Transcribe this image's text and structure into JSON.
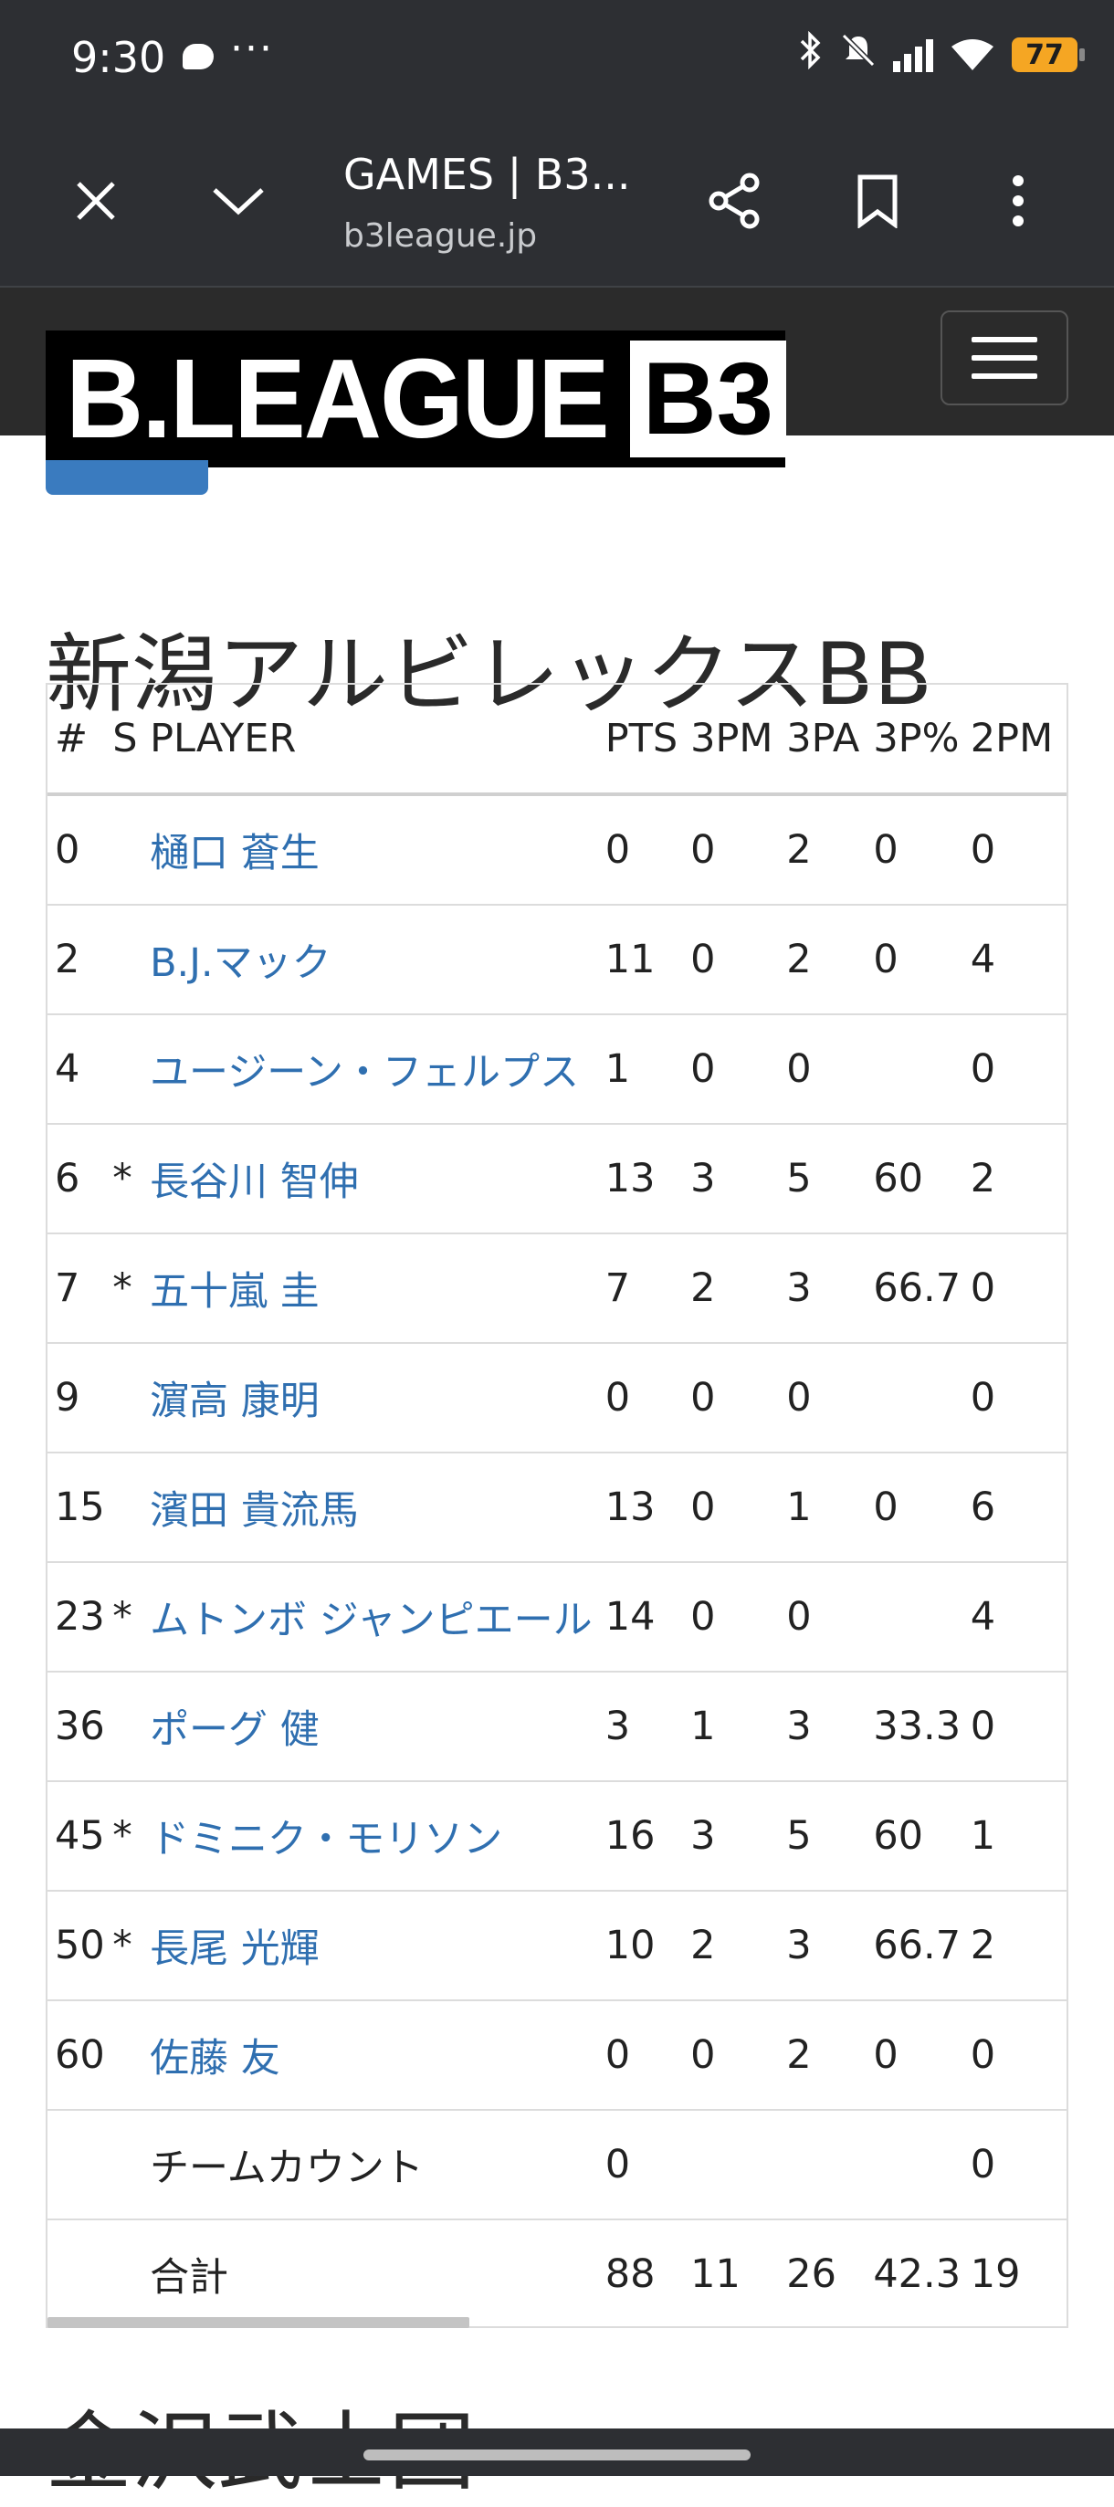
{
  "status_bar": {
    "time": "9:30",
    "dots": "···",
    "battery": "77"
  },
  "browser": {
    "title": "GAMES | B3...",
    "url": "b3league.jp",
    "icons": [
      "close-icon",
      "chevron-down-icon",
      "share-icon",
      "bookmark-icon",
      "more-vert-icon"
    ]
  },
  "site": {
    "logo_text": "B.LEAGUE",
    "logo_badge": "B3"
  },
  "team": {
    "name": "新潟アルビレックスBB"
  },
  "table": {
    "headers": {
      "num": "#",
      "s": "S",
      "player": "PLAYER",
      "pts": "PTS",
      "tpm": "3PM",
      "tpa": "3PA",
      "tpp": "3P%",
      "twopm": "2PM"
    },
    "rows": [
      {
        "num": "0",
        "s": "",
        "player": "樋口 蒼生",
        "pts": "0",
        "tpm": "0",
        "tpa": "2",
        "tpp": "0",
        "twopm": "0"
      },
      {
        "num": "2",
        "s": "",
        "player": "B.J.マック",
        "pts": "11",
        "tpm": "0",
        "tpa": "2",
        "tpp": "0",
        "twopm": "4"
      },
      {
        "num": "4",
        "s": "",
        "player": "ユージーン・フェルプス",
        "pts": "1",
        "tpm": "0",
        "tpa": "0",
        "tpp": "",
        "twopm": "0"
      },
      {
        "num": "6",
        "s": "*",
        "player": "長谷川 智伸",
        "pts": "13",
        "tpm": "3",
        "tpa": "5",
        "tpp": "60",
        "twopm": "2"
      },
      {
        "num": "7",
        "s": "*",
        "player": "五十嵐 圭",
        "pts": "7",
        "tpm": "2",
        "tpa": "3",
        "tpp": "66.7",
        "twopm": "0"
      },
      {
        "num": "9",
        "s": "",
        "player": "濵高 康明",
        "pts": "0",
        "tpm": "0",
        "tpa": "0",
        "tpp": "",
        "twopm": "0"
      },
      {
        "num": "15",
        "s": "",
        "player": "濱田 貴流馬",
        "pts": "13",
        "tpm": "0",
        "tpa": "1",
        "tpp": "0",
        "twopm": "6"
      },
      {
        "num": "23",
        "s": "*",
        "player": "ムトンボ ジャンピエール",
        "pts": "14",
        "tpm": "0",
        "tpa": "0",
        "tpp": "",
        "twopm": "4"
      },
      {
        "num": "36",
        "s": "",
        "player": "ポーグ 健",
        "pts": "3",
        "tpm": "1",
        "tpa": "3",
        "tpp": "33.3",
        "twopm": "0"
      },
      {
        "num": "45",
        "s": "*",
        "player": "ドミニク・モリソン",
        "pts": "16",
        "tpm": "3",
        "tpa": "5",
        "tpp": "60",
        "twopm": "1"
      },
      {
        "num": "50",
        "s": "*",
        "player": "長尾 光輝",
        "pts": "10",
        "tpm": "2",
        "tpa": "3",
        "tpp": "66.7",
        "twopm": "2"
      },
      {
        "num": "60",
        "s": "",
        "player": "佐藤 友",
        "pts": "0",
        "tpm": "0",
        "tpa": "2",
        "tpp": "0",
        "twopm": "0"
      }
    ],
    "team_count": {
      "label": "チームカウント",
      "pts": "0",
      "twopm": "0"
    },
    "total": {
      "label": "合計",
      "pts": "88",
      "tpm": "11",
      "tpa": "26",
      "tpp": "42.3",
      "twopm": "19"
    }
  },
  "next_team_partial": "金沢武士団"
}
